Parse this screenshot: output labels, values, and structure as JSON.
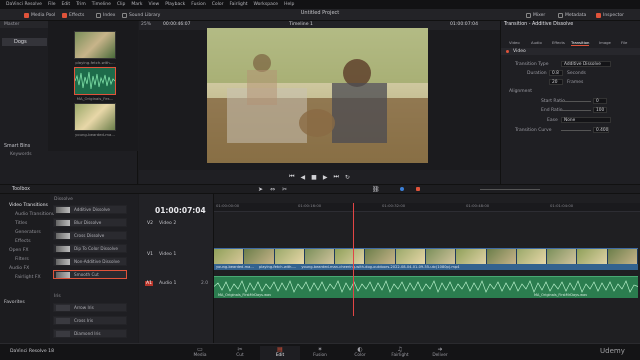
{
  "menubar": {
    "items": [
      "DaVinci Resolve",
      "File",
      "Edit",
      "Trim",
      "Timeline",
      "Clip",
      "Mark",
      "View",
      "Playback",
      "Fusion",
      "Color",
      "Fairlight",
      "Workspace",
      "Help"
    ],
    "window_title": "Untitled Project"
  },
  "toolbar": {
    "media_pool": "Media Pool",
    "effects": "Effects",
    "index": "Index",
    "sound_library": "Sound Library",
    "mixer": "Mixer",
    "metadata": "Metadata",
    "inspector": "Inspector"
  },
  "viewer": {
    "zoom": "25%",
    "timecode_left": "00:00:46:07",
    "timeline_name": "Timeline 1",
    "timecode_right": "01:00:07:04"
  },
  "media_pool": {
    "header": "Master",
    "bin": "Dogs",
    "smart_bins": "Smart Bins",
    "keywords": "Keywords",
    "clips": [
      {
        "label": "playing-fetch-with-..."
      },
      {
        "label": "MA_Originals_Fes..."
      },
      {
        "label": "young-bearded-ma..."
      }
    ]
  },
  "inspector": {
    "title": "Transition - Additive Dissolve",
    "tabs": [
      "Video",
      "Audio",
      "Effects",
      "Transition",
      "Image",
      "File"
    ],
    "active_tab": "Transition",
    "section": "Video",
    "rows": [
      {
        "label": "Transition Type",
        "value": "Additive Dissolve"
      },
      {
        "label": "Duration",
        "value": "0.8",
        "unit": "Seconds"
      },
      {
        "label": "",
        "value": "20",
        "unit": "Frames"
      },
      {
        "label": "Alignment",
        "value": ""
      },
      {
        "label": "Start Ratio",
        "value": "0"
      },
      {
        "label": "End Ratio",
        "value": "100"
      },
      {
        "label": "Ease",
        "value": "None"
      },
      {
        "label": "Transition Curve",
        "value": "0.400"
      }
    ]
  },
  "effects": {
    "toolbox": "Toolbox",
    "categories": [
      "Video Transitions",
      "Audio Transitions",
      "Titles",
      "Generators",
      "Effects",
      "Open FX",
      "Filters",
      "Audio FX",
      "Fairlight FX",
      "Favorites"
    ],
    "active_category": "Video Transitions",
    "dissolve_header": "Dissolve",
    "items": [
      "Additive Dissolve",
      "Blur Dissolve",
      "Cross Dissolve",
      "Dip To Color Dissolve",
      "Non-Additive Dissolve",
      "Smooth Cut"
    ],
    "iris_header": "Iris",
    "iris_items": [
      "Arrow Iris",
      "Cross Iris",
      "Diamond Iris"
    ]
  },
  "timeline": {
    "timecode": "01:00:07:04",
    "ruler": [
      "01:00:00:00",
      "01:00:16:00",
      "01:00:32:00",
      "01:00:48:00",
      "01:01:04:00"
    ],
    "tracks": [
      {
        "id": "V2",
        "name": "Video 2"
      },
      {
        "id": "V1",
        "name": "Video 1"
      },
      {
        "id": "A1",
        "name": "Audio 1",
        "level": "2.0"
      }
    ],
    "video_clip_labels": [
      "young-bearded-ma...",
      "playing-fetch-with-...",
      "young-bearded-man-cheering-with-dog-outdoors-2022-08-04-01-09-55-utc(1080p).mp4"
    ],
    "audio_clip_label": "MA_Originals_FirstMrDays.wav",
    "audio_clip_label_2": "MA_Originals_FirstMrDays.wav"
  },
  "pages": [
    {
      "name": "Media",
      "icon": "media-icon"
    },
    {
      "name": "Cut",
      "icon": "cut-icon"
    },
    {
      "name": "Edit",
      "icon": "edit-icon"
    },
    {
      "name": "Fusion",
      "icon": "fusion-icon"
    },
    {
      "name": "Color",
      "icon": "color-icon"
    },
    {
      "name": "Fairlight",
      "icon": "fairlight-icon"
    },
    {
      "name": "Deliver",
      "icon": "deliver-icon"
    }
  ],
  "active_page": "Edit",
  "app_name": "DaVinci Resolve 18",
  "watermark": "Udemy",
  "colors": {
    "accent": "#e0533a",
    "video_clip": "#2b4d7a",
    "audio_clip": "#2b7d4f"
  }
}
